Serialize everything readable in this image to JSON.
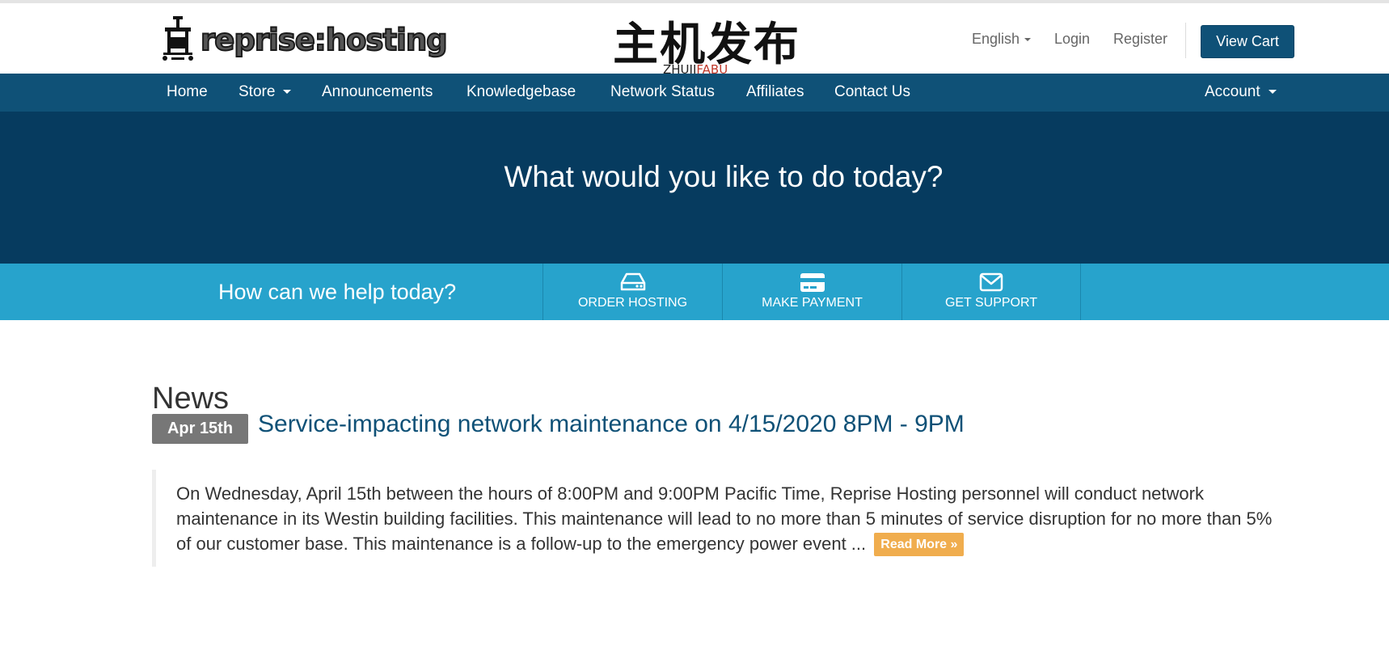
{
  "header": {
    "logo_text": "reprise:hosting",
    "watermark_cn": "主机发布",
    "watermark_en_a": "ZHUJI",
    "watermark_en_b": "FABU",
    "language": "English",
    "login": "Login",
    "register": "Register",
    "view_cart": "View Cart"
  },
  "nav": {
    "items": [
      "Home",
      "Store",
      "Announcements",
      "Knowledgebase",
      "Network Status",
      "Affiliates",
      "Contact Us"
    ],
    "account": "Account"
  },
  "hero": {
    "title": "What would you like to do today?"
  },
  "helpbar": {
    "prompt": "How can we help today?",
    "actions": [
      "ORDER HOSTING",
      "MAKE PAYMENT",
      "GET SUPPORT"
    ],
    "icons": [
      "hosting-server-icon",
      "credit-card-icon",
      "envelope-icon"
    ]
  },
  "news": {
    "heading": "News",
    "items": [
      {
        "date": "Apr 15th",
        "title": "Service-impacting network maintenance on 4/15/2020 8PM - 9PM",
        "excerpt": "On Wednesday, April 15th between the hours of 8:00PM and 9:00PM Pacific Time, Reprise Hosting personnel will conduct network maintenance in its Westin building facilities. This maintenance will lead to no more than 5 minutes of service disruption for no more than 5% of our customer base. This maintenance is a follow-up to the emergency power event ...",
        "read_more": "Read More »"
      }
    ]
  },
  "colors": {
    "brand": "#0f5177",
    "hero": "#063b5f",
    "helpbar": "#27a3cc",
    "read_more": "#f0ad4e",
    "date_badge": "#777777"
  }
}
